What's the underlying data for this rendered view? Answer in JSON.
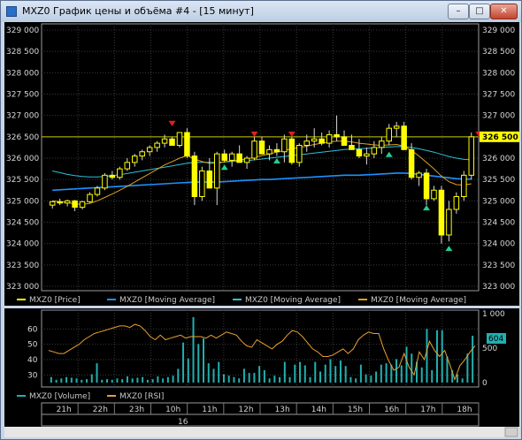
{
  "window": {
    "title": "MXZ0 График цены и объёма #4 - [15 минут]",
    "buttons": {
      "minimize": "–",
      "maximize": "□",
      "close": "✕"
    }
  },
  "colors": {
    "background": "#000000",
    "candle_bull": "#ffff00",
    "candle_bear": "#ffff00",
    "ma_fast": "#e0a020",
    "ma_slow1": "#1e90ff",
    "ma_slow2": "#2ec0d8",
    "volume": "#20b0b0",
    "rsi": "#e8a030",
    "price_line": "#c8c800",
    "buy_marker": "#20d090",
    "sell_marker": "#e02020"
  },
  "price_panel": {
    "y_ticks": [
      "329 000",
      "328 500",
      "328 000",
      "327 500",
      "327 000",
      "326 500",
      "326 000",
      "325 500",
      "325 000",
      "324 500",
      "324 000",
      "323 500",
      "323 000"
    ],
    "current_price_label": "326 500",
    "legend": [
      {
        "label": "MXZ0 [Price]",
        "color": "#ffff00"
      },
      {
        "label": "MXZ0 [Moving Average]",
        "color": "#1e90ff"
      },
      {
        "label": "MXZ0 [Moving Average]",
        "color": "#2ec0d8"
      },
      {
        "label": "MXZ0 [Moving Average]",
        "color": "#e0a020"
      }
    ]
  },
  "volume_panel": {
    "left_ticks": [
      "60",
      "50",
      "40",
      "30"
    ],
    "right_ticks": [
      "1 000",
      "500",
      "0"
    ],
    "current_volume_label": "604",
    "legend": [
      {
        "label": "MXZ0 [Volume]",
        "color": "#20b0b0"
      },
      {
        "label": "MXZ0 [RSI]",
        "color": "#e8a030"
      }
    ]
  },
  "time_axis": {
    "labels": [
      "21h",
      "22h",
      "23h",
      "10h",
      "11h",
      "12h",
      "13h",
      "14h",
      "15h",
      "16h",
      "17h",
      "18h"
    ],
    "date_label": "16"
  },
  "chart_data": [
    {
      "type": "candlestick",
      "ylim": [
        323000,
        329000
      ],
      "candles": [
        [
          324900,
          325000,
          324820,
          324980
        ],
        [
          324980,
          325050,
          324900,
          324950
        ],
        [
          324950,
          325030,
          324870,
          325000
        ],
        [
          325000,
          325020,
          324760,
          324850
        ],
        [
          324850,
          325000,
          324800,
          324980
        ],
        [
          324980,
          325200,
          324950,
          325150
        ],
        [
          325150,
          325350,
          325100,
          325300
        ],
        [
          325300,
          325650,
          325250,
          325600
        ],
        [
          325600,
          325700,
          325500,
          325550
        ],
        [
          325550,
          325800,
          325500,
          325750
        ],
        [
          325750,
          326000,
          325700,
          325900
        ],
        [
          325900,
          326100,
          325800,
          326050
        ],
        [
          326050,
          326200,
          325950,
          326150
        ],
        [
          326150,
          326300,
          326050,
          326250
        ],
        [
          326250,
          326400,
          326150,
          326350
        ],
        [
          326350,
          326550,
          326250,
          326450
        ],
        [
          326450,
          326500,
          326300,
          326300
        ],
        [
          326300,
          326600,
          326250,
          326600
        ],
        [
          326600,
          326700,
          326000,
          326050
        ],
        [
          326050,
          326150,
          324900,
          325100
        ],
        [
          325100,
          325800,
          325000,
          325700
        ],
        [
          325700,
          326000,
          325400,
          325300
        ],
        [
          325300,
          326150,
          324900,
          326100
        ],
        [
          326100,
          326200,
          325900,
          325950
        ],
        [
          325950,
          326150,
          325800,
          326100
        ],
        [
          326100,
          326300,
          325950,
          325900
        ],
        [
          325900,
          326050,
          325750,
          326000
        ],
        [
          326000,
          326500,
          325950,
          326400
        ],
        [
          326400,
          326500,
          326100,
          326100
        ],
        [
          326100,
          326300,
          325950,
          326200
        ],
        [
          326200,
          326350,
          326050,
          326150
        ],
        [
          326150,
          326550,
          325900,
          326450
        ],
        [
          326450,
          326500,
          325850,
          325900
        ],
        [
          325900,
          326350,
          325800,
          326300
        ],
        [
          326300,
          326550,
          326150,
          326400
        ],
        [
          326400,
          326700,
          326250,
          326450
        ],
        [
          326450,
          326600,
          326300,
          326350
        ],
        [
          326350,
          326650,
          326250,
          326550
        ],
        [
          326550,
          327000,
          326400,
          326500
        ],
        [
          326500,
          326650,
          326300,
          326300
        ],
        [
          326300,
          326550,
          326200,
          326200
        ],
        [
          326200,
          326450,
          326000,
          326050
        ],
        [
          326050,
          326250,
          325850,
          326100
        ],
        [
          326100,
          326400,
          326000,
          326250
        ],
        [
          326250,
          326500,
          326100,
          326400
        ],
        [
          326400,
          326800,
          326300,
          326700
        ],
        [
          326700,
          326850,
          326500,
          326750
        ],
        [
          326750,
          326850,
          326200,
          326200
        ],
        [
          326200,
          326350,
          325500,
          325550
        ],
        [
          325550,
          325700,
          325350,
          325650
        ],
        [
          325650,
          325750,
          324900,
          325050
        ],
        [
          325050,
          325350,
          325000,
          325250
        ],
        [
          325250,
          325350,
          324000,
          324200
        ],
        [
          324200,
          325000,
          324050,
          324800
        ],
        [
          324800,
          325200,
          324700,
          325100
        ],
        [
          325100,
          325700,
          325000,
          325600
        ],
        [
          325600,
          326600,
          325500,
          326500
        ]
      ],
      "price_line": 326500,
      "ma_fast": [
        325000,
        324980,
        324960,
        324930,
        324920,
        324940,
        325000,
        325080,
        325160,
        325250,
        325340,
        325440,
        325540,
        325640,
        325740,
        325840,
        325920,
        326000,
        326060,
        325980,
        325920,
        325880,
        325880,
        325910,
        325940,
        325960,
        325980,
        326020,
        326060,
        326100,
        326140,
        326180,
        326220,
        326250,
        326280,
        326320,
        326350,
        326380,
        326400,
        326400,
        326380,
        326350,
        326330,
        326310,
        326300,
        326310,
        326320,
        326280,
        326180,
        326050,
        325900,
        325750,
        325580,
        325450,
        325380,
        325370,
        325400
      ],
      "ma_slow1": [
        325250,
        325260,
        325270,
        325280,
        325290,
        325300,
        325310,
        325320,
        325330,
        325340,
        325350,
        325360,
        325370,
        325380,
        325390,
        325400,
        325410,
        325420,
        325430,
        325440,
        325440,
        325440,
        325440,
        325450,
        325460,
        325470,
        325480,
        325490,
        325500,
        325500,
        325510,
        325520,
        325530,
        325540,
        325550,
        325560,
        325570,
        325580,
        325590,
        325600,
        325600,
        325600,
        325610,
        325620,
        325630,
        325640,
        325650,
        325650,
        325640,
        325620,
        325600,
        325580,
        325560,
        325540,
        325520,
        325510,
        325510
      ],
      "ma_slow2": [
        325700,
        325660,
        325620,
        325590,
        325570,
        325560,
        325560,
        325570,
        325590,
        325610,
        325640,
        325670,
        325700,
        325730,
        325760,
        325790,
        325820,
        325850,
        325880,
        325900,
        325900,
        325900,
        325900,
        325910,
        325920,
        325930,
        325940,
        325960,
        325980,
        326000,
        326020,
        326040,
        326060,
        326080,
        326100,
        326120,
        326140,
        326160,
        326180,
        326200,
        326210,
        326220,
        326230,
        326240,
        326250,
        326260,
        326270,
        326270,
        326250,
        326220,
        326180,
        326140,
        326090,
        326040,
        326000,
        325970,
        325960
      ],
      "buy_markers": [
        [
          23,
          325850
        ],
        [
          30,
          326000
        ],
        [
          45,
          326150
        ],
        [
          50,
          324900
        ],
        [
          53,
          323950
        ]
      ],
      "sell_markers": [
        [
          16,
          326750
        ],
        [
          27,
          326500
        ],
        [
          32,
          326500
        ],
        [
          57,
          326500
        ]
      ]
    },
    {
      "type": "bar",
      "series_name": "MXZ0 [Volume]",
      "ylim": [
        0,
        1000
      ],
      "values": [
        80,
        40,
        60,
        80,
        70,
        60,
        40,
        50,
        120,
        280,
        40,
        50,
        40,
        60,
        50,
        90,
        60,
        70,
        80,
        40,
        50,
        90,
        60,
        80,
        100,
        200,
        580,
        350,
        950,
        560,
        640,
        280,
        200,
        300,
        120,
        100,
        80,
        60,
        200,
        140,
        140,
        240,
        180,
        60,
        100,
        80,
        300,
        80,
        260,
        300,
        250,
        80,
        300,
        160,
        260,
        340,
        240,
        320,
        240,
        80,
        60,
        260,
        120,
        100,
        160,
        260,
        280,
        260,
        340,
        250,
        520,
        420,
        300,
        220,
        780,
        180,
        760,
        760,
        380,
        180,
        120,
        60,
        420,
        680
      ]
    },
    {
      "type": "line",
      "series_name": "MXZ0 [RSI]",
      "ylim": [
        25,
        70
      ],
      "values": [
        46,
        45,
        44,
        44,
        46,
        48,
        50,
        53,
        55,
        57,
        58,
        59,
        60,
        61,
        62,
        62,
        61,
        63,
        62,
        59,
        55,
        53,
        56,
        53,
        54,
        55,
        56,
        54,
        55,
        55,
        55,
        54,
        56,
        54,
        56,
        58,
        57,
        56,
        52,
        49,
        48,
        53,
        51,
        49,
        47,
        50,
        52,
        56,
        59,
        58,
        55,
        51,
        47,
        45,
        42,
        42,
        43,
        45,
        47,
        44,
        47,
        53,
        56,
        58,
        57,
        57,
        47,
        39,
        33,
        35,
        44,
        35,
        30,
        45,
        40,
        52,
        46,
        42,
        46,
        37,
        27,
        36,
        40,
        45,
        49
      ]
    }
  ]
}
